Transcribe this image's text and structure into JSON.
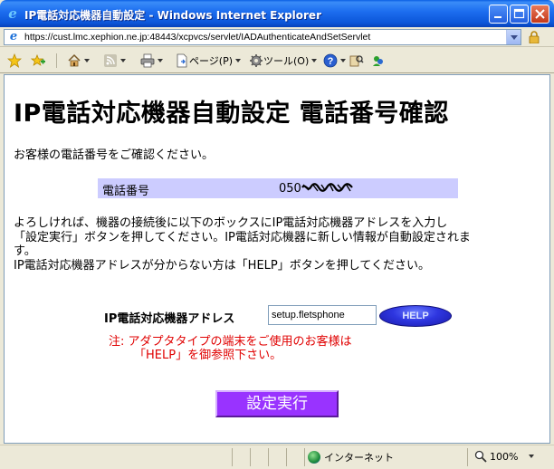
{
  "window": {
    "title": "IP電話対応機器自動設定 - Windows Internet Explorer"
  },
  "address_bar": {
    "url": "https://cust.lmc.xephion.ne.jp:48443/xcpvcs/servlet/IADAuthenticateAndSetServlet"
  },
  "command_bar": {
    "page_menu": "ページ(P)",
    "tools_menu": "ツール(O)"
  },
  "page": {
    "title": "IP電話対応機器自動設定 電話番号確認",
    "intro": "お客様の電話番号をご確認ください。",
    "phone_label": "電話番号",
    "phone_value": "050",
    "instructions": [
      "よろしければ、機器の接続後に以下のボックスにIP電話対応機器アドレスを入力し",
      "「設定実行」ボタンを押してください。IP電話対応機器に新しい情報が自動設定されま",
      "す。",
      "IP電話対応機器アドレスが分からない方は「HELP」ボタンを押してください。"
    ],
    "address_label": "IP電話対応機器アドレス",
    "address_value": "setup.fletsphone",
    "help_button": "HELP",
    "note_line1": "注: アダプタタイプの端末をご使用のお客様は",
    "note_line2": "「HELP」を御参照下さい。",
    "submit_button": "設定実行"
  },
  "status_bar": {
    "zone": "インターネット",
    "zoom": "100%"
  },
  "colors": {
    "phone_row_bg": "#ccccff",
    "submit_bg": "#9933ff",
    "note_text": "#e00000",
    "help_bg": "#2e36e0"
  }
}
